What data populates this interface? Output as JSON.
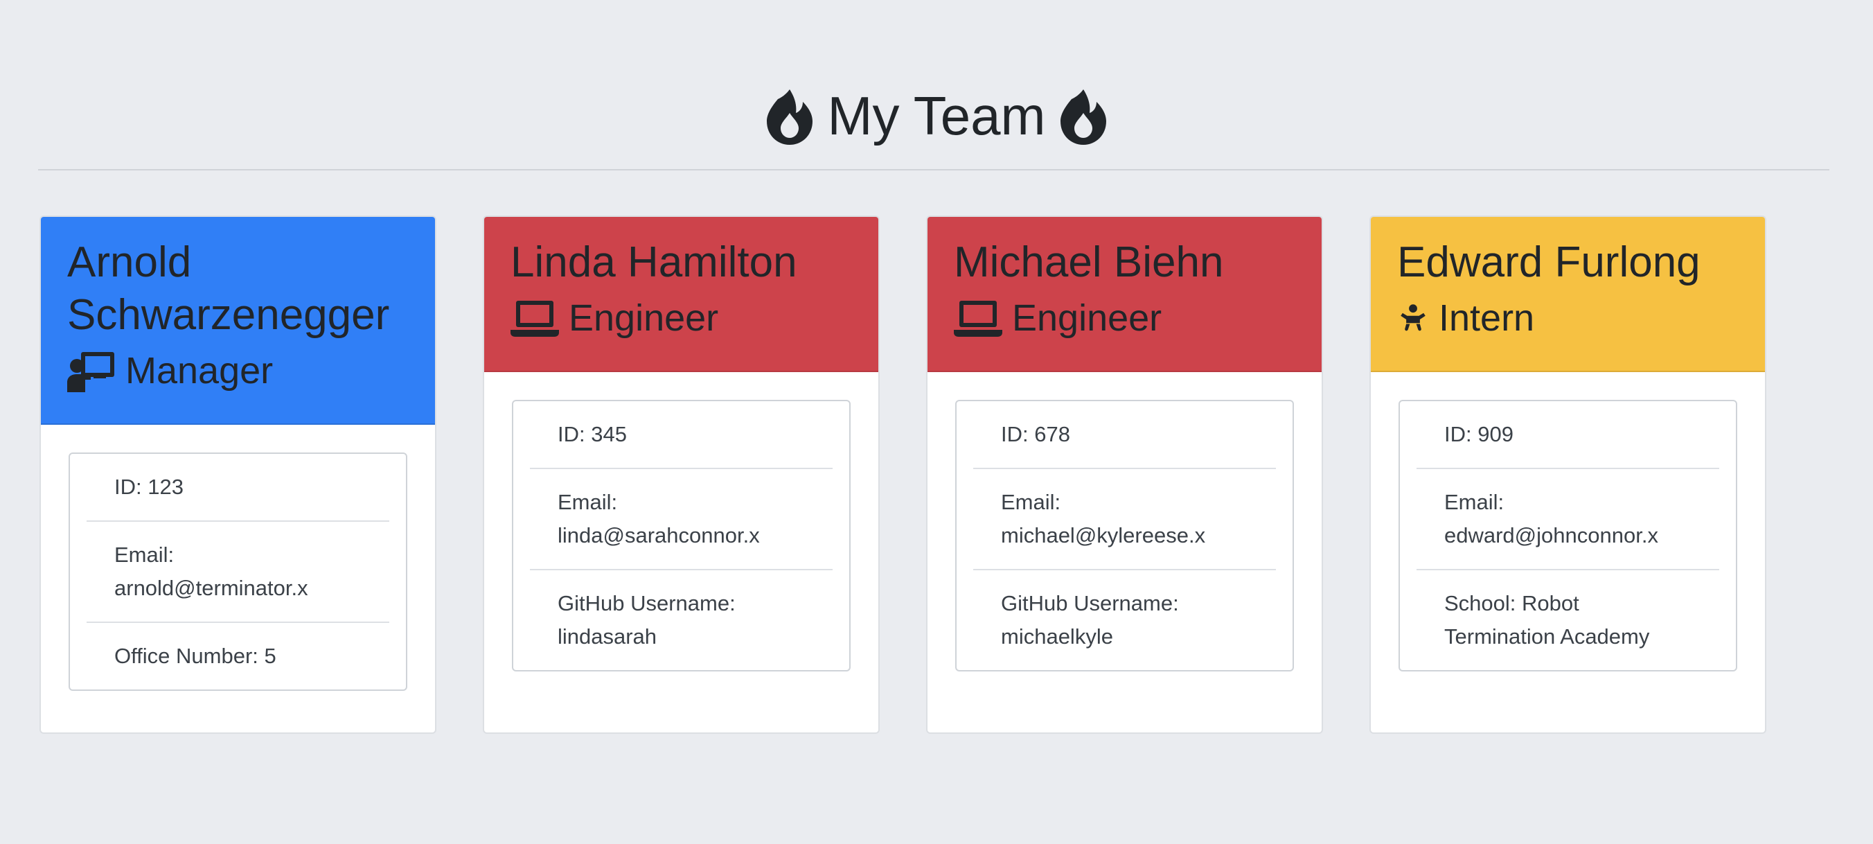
{
  "page": {
    "title": "My Team",
    "header_icon": "fire-icon",
    "background": "#eaecf0"
  },
  "team": [
    {
      "name": "Arnold Schwarzenegger",
      "role": "Manager",
      "role_icon": "manager-teacher-icon",
      "header_color": "#307ff6",
      "details": [
        "ID: 123",
        "Email: arnold@terminator.x",
        "Office Number: 5"
      ]
    },
    {
      "name": "Linda Hamilton",
      "role": "Engineer",
      "role_icon": "laptop-icon",
      "header_color": "#cd434b",
      "details": [
        "ID: 345",
        "Email: linda@sarahconnor.x",
        "GitHub Username: lindasarah"
      ]
    },
    {
      "name": "Michael Biehn",
      "role": "Engineer",
      "role_icon": "laptop-icon",
      "header_color": "#cd434b",
      "details": [
        "ID: 678",
        "Email: michael@kylereese.x",
        "GitHub Username: michaelkyle"
      ]
    },
    {
      "name": "Edward Furlong",
      "role": "Intern",
      "role_icon": "baby-icon",
      "header_color": "#f6c142",
      "details": [
        "ID: 909",
        "Email: edward@johnconnor.x",
        "School: Robot Termination Academy"
      ]
    }
  ]
}
